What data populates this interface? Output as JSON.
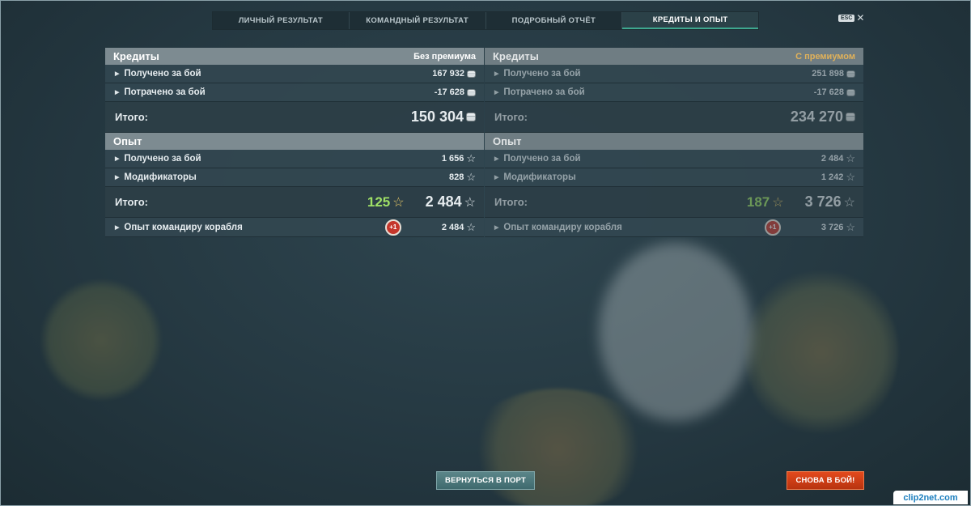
{
  "tabs": [
    {
      "label": "ЛИЧНЫЙ РЕЗУЛЬТАТ",
      "active": false
    },
    {
      "label": "КОМАНДНЫЙ РЕЗУЛЬТАТ",
      "active": false
    },
    {
      "label": "ПОДРОБНЫЙ ОТЧЁТ",
      "active": false
    },
    {
      "label": "КРЕДИТЫ И ОПЫТ",
      "active": true
    }
  ],
  "close": {
    "key": "ESC",
    "symbol": "✕"
  },
  "without_premium": {
    "credits": {
      "title": "Кредиты",
      "side_label": "Без премиума",
      "earned_label": "Получено за бой",
      "earned": "167 932",
      "spent_label": "Потрачено за бой",
      "spent": "-17 628",
      "total_label": "Итого:",
      "total": "150 304"
    },
    "xp": {
      "title": "Опыт",
      "earned_label": "Получено за бой",
      "earned": "1 656",
      "mods_label": "Модификаторы",
      "mods": "828",
      "total_label": "Итого:",
      "free_xp": "125",
      "total": "2 484",
      "commander_label": "Опыт командиру корабля",
      "commander_badge": "+1",
      "commander": "2 484"
    }
  },
  "with_premium": {
    "credits": {
      "title": "Кредиты",
      "side_label": "С премиумом",
      "earned_label": "Получено за бой",
      "earned": "251 898",
      "spent_label": "Потрачено за бой",
      "spent": "-17 628",
      "total_label": "Итого:",
      "total": "234 270"
    },
    "xp": {
      "title": "Опыт",
      "earned_label": "Получено за бой",
      "earned": "2 484",
      "mods_label": "Модификаторы",
      "mods": "1 242",
      "total_label": "Итого:",
      "free_xp": "187",
      "total": "3 726",
      "commander_label": "Опыт командиру корабля",
      "commander_badge": "+1",
      "commander": "3 726"
    }
  },
  "buttons": {
    "port": "ВЕРНУТЬСЯ В ПОРТ",
    "battle": "СНОВА В БОЙ!"
  },
  "watermark": "clip2net.com",
  "colors": {
    "premium": "#e0b15a",
    "free_xp": "#9fe066",
    "battle": "#d33d15",
    "active_tab": "#3ea78f"
  }
}
